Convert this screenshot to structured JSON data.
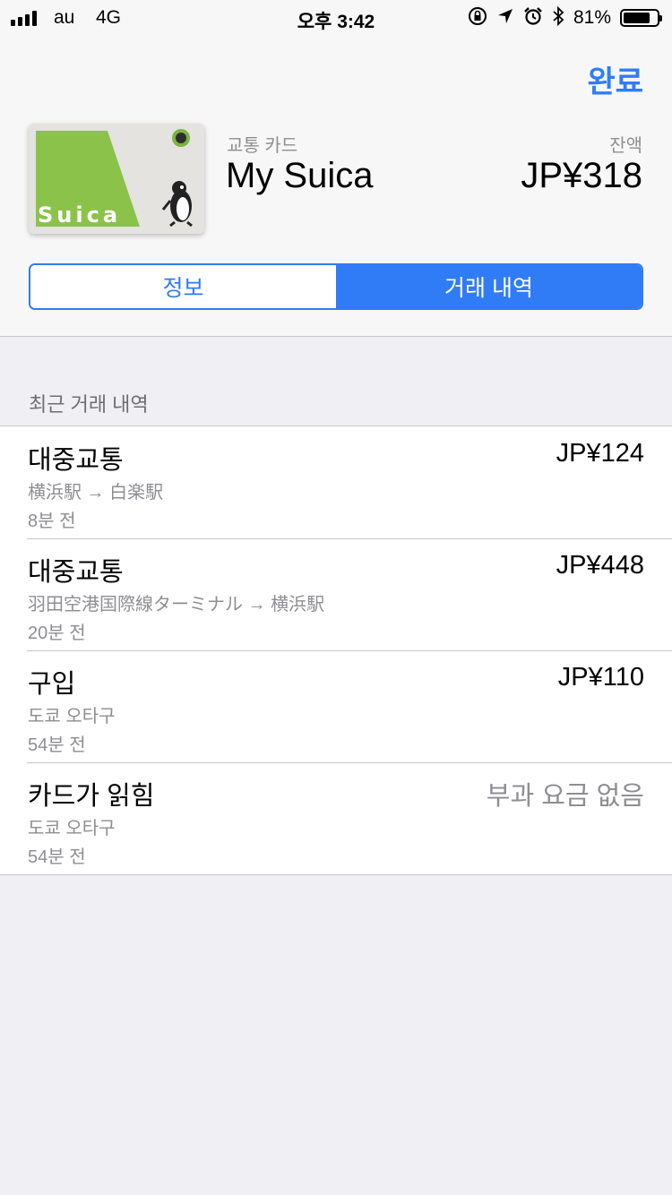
{
  "status_bar": {
    "carrier": "au",
    "network": "4G",
    "time": "오후 3:42",
    "battery_percent": "81%",
    "battery_level": 0.81,
    "icons": [
      "orientation-lock-icon",
      "location-arrow-icon",
      "alarm-icon",
      "bluetooth-icon"
    ]
  },
  "header": {
    "done_label": "완료"
  },
  "card": {
    "type_label": "교통 카드",
    "name": "My Suica",
    "balance_label": "잔액",
    "balance": "JP¥318",
    "brand_text": "Suica",
    "brand_color": "#8bc34a"
  },
  "segments": [
    {
      "label": "정보",
      "active": false
    },
    {
      "label": "거래 내역",
      "active": true
    }
  ],
  "section_title": "최근 거래 내역",
  "transactions": [
    {
      "title": "대중교통",
      "location": "横浜駅 → 白楽駅",
      "time": "8분 전",
      "amount": "JP¥124"
    },
    {
      "title": "대중교통",
      "location": "羽田空港国際線ターミナル → 横浜駅",
      "time": "20분 전",
      "amount": "JP¥448"
    },
    {
      "title": "구입",
      "location": "도쿄 오타구",
      "time": "54분 전",
      "amount": "JP¥110"
    },
    {
      "title": "카드가 읽힘",
      "location": "도쿄 오타구",
      "time": "54분 전",
      "amount": "부과 요금 없음"
    }
  ],
  "colors": {
    "accent": "#2f7cf6",
    "background": "#efeff4",
    "secondary_text": "#8e8e93"
  }
}
